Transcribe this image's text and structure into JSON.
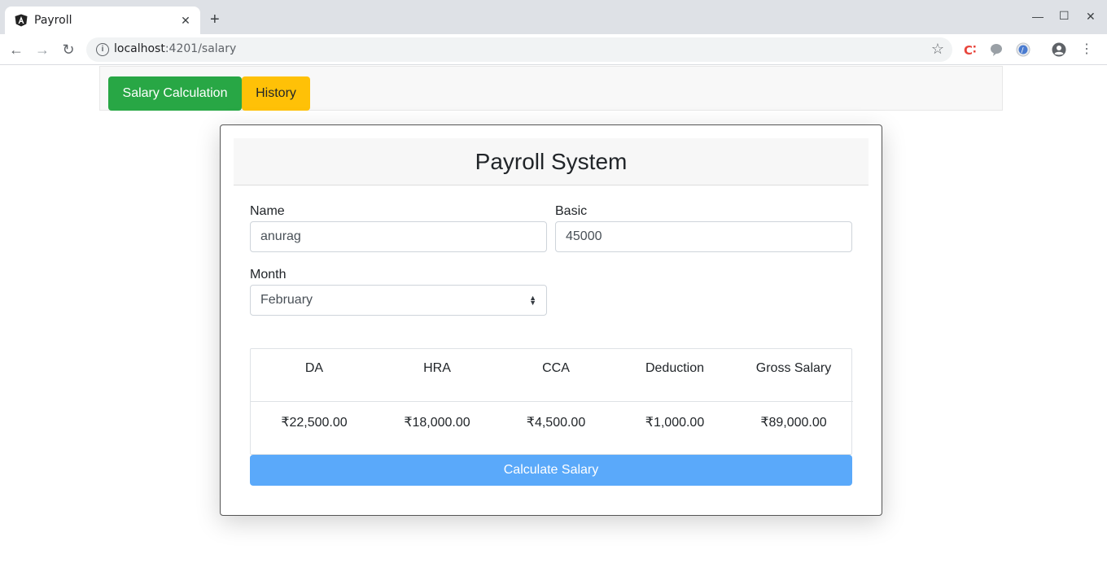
{
  "browser": {
    "tab_title": "Payroll",
    "url_host": "localhost",
    "url_path": ":4201/salary"
  },
  "nav": {
    "salary_calc_label": "Salary Calculation",
    "history_label": "History"
  },
  "card": {
    "title": "Payroll System",
    "name_label": "Name",
    "name_value": "anurag",
    "basic_label": "Basic",
    "basic_value": "45000",
    "month_label": "Month",
    "month_value": "February"
  },
  "table": {
    "headers": [
      "DA",
      "HRA",
      "CCA",
      "Deduction",
      "Gross Salary"
    ],
    "values": [
      "₹22,500.00",
      "₹18,000.00",
      "₹4,500.00",
      "₹1,000.00",
      "₹89,000.00"
    ]
  },
  "calculate_label": "Calculate Salary",
  "colors": {
    "green": "#28a745",
    "yellow": "#ffc107",
    "blue": "#5aa9fa"
  }
}
